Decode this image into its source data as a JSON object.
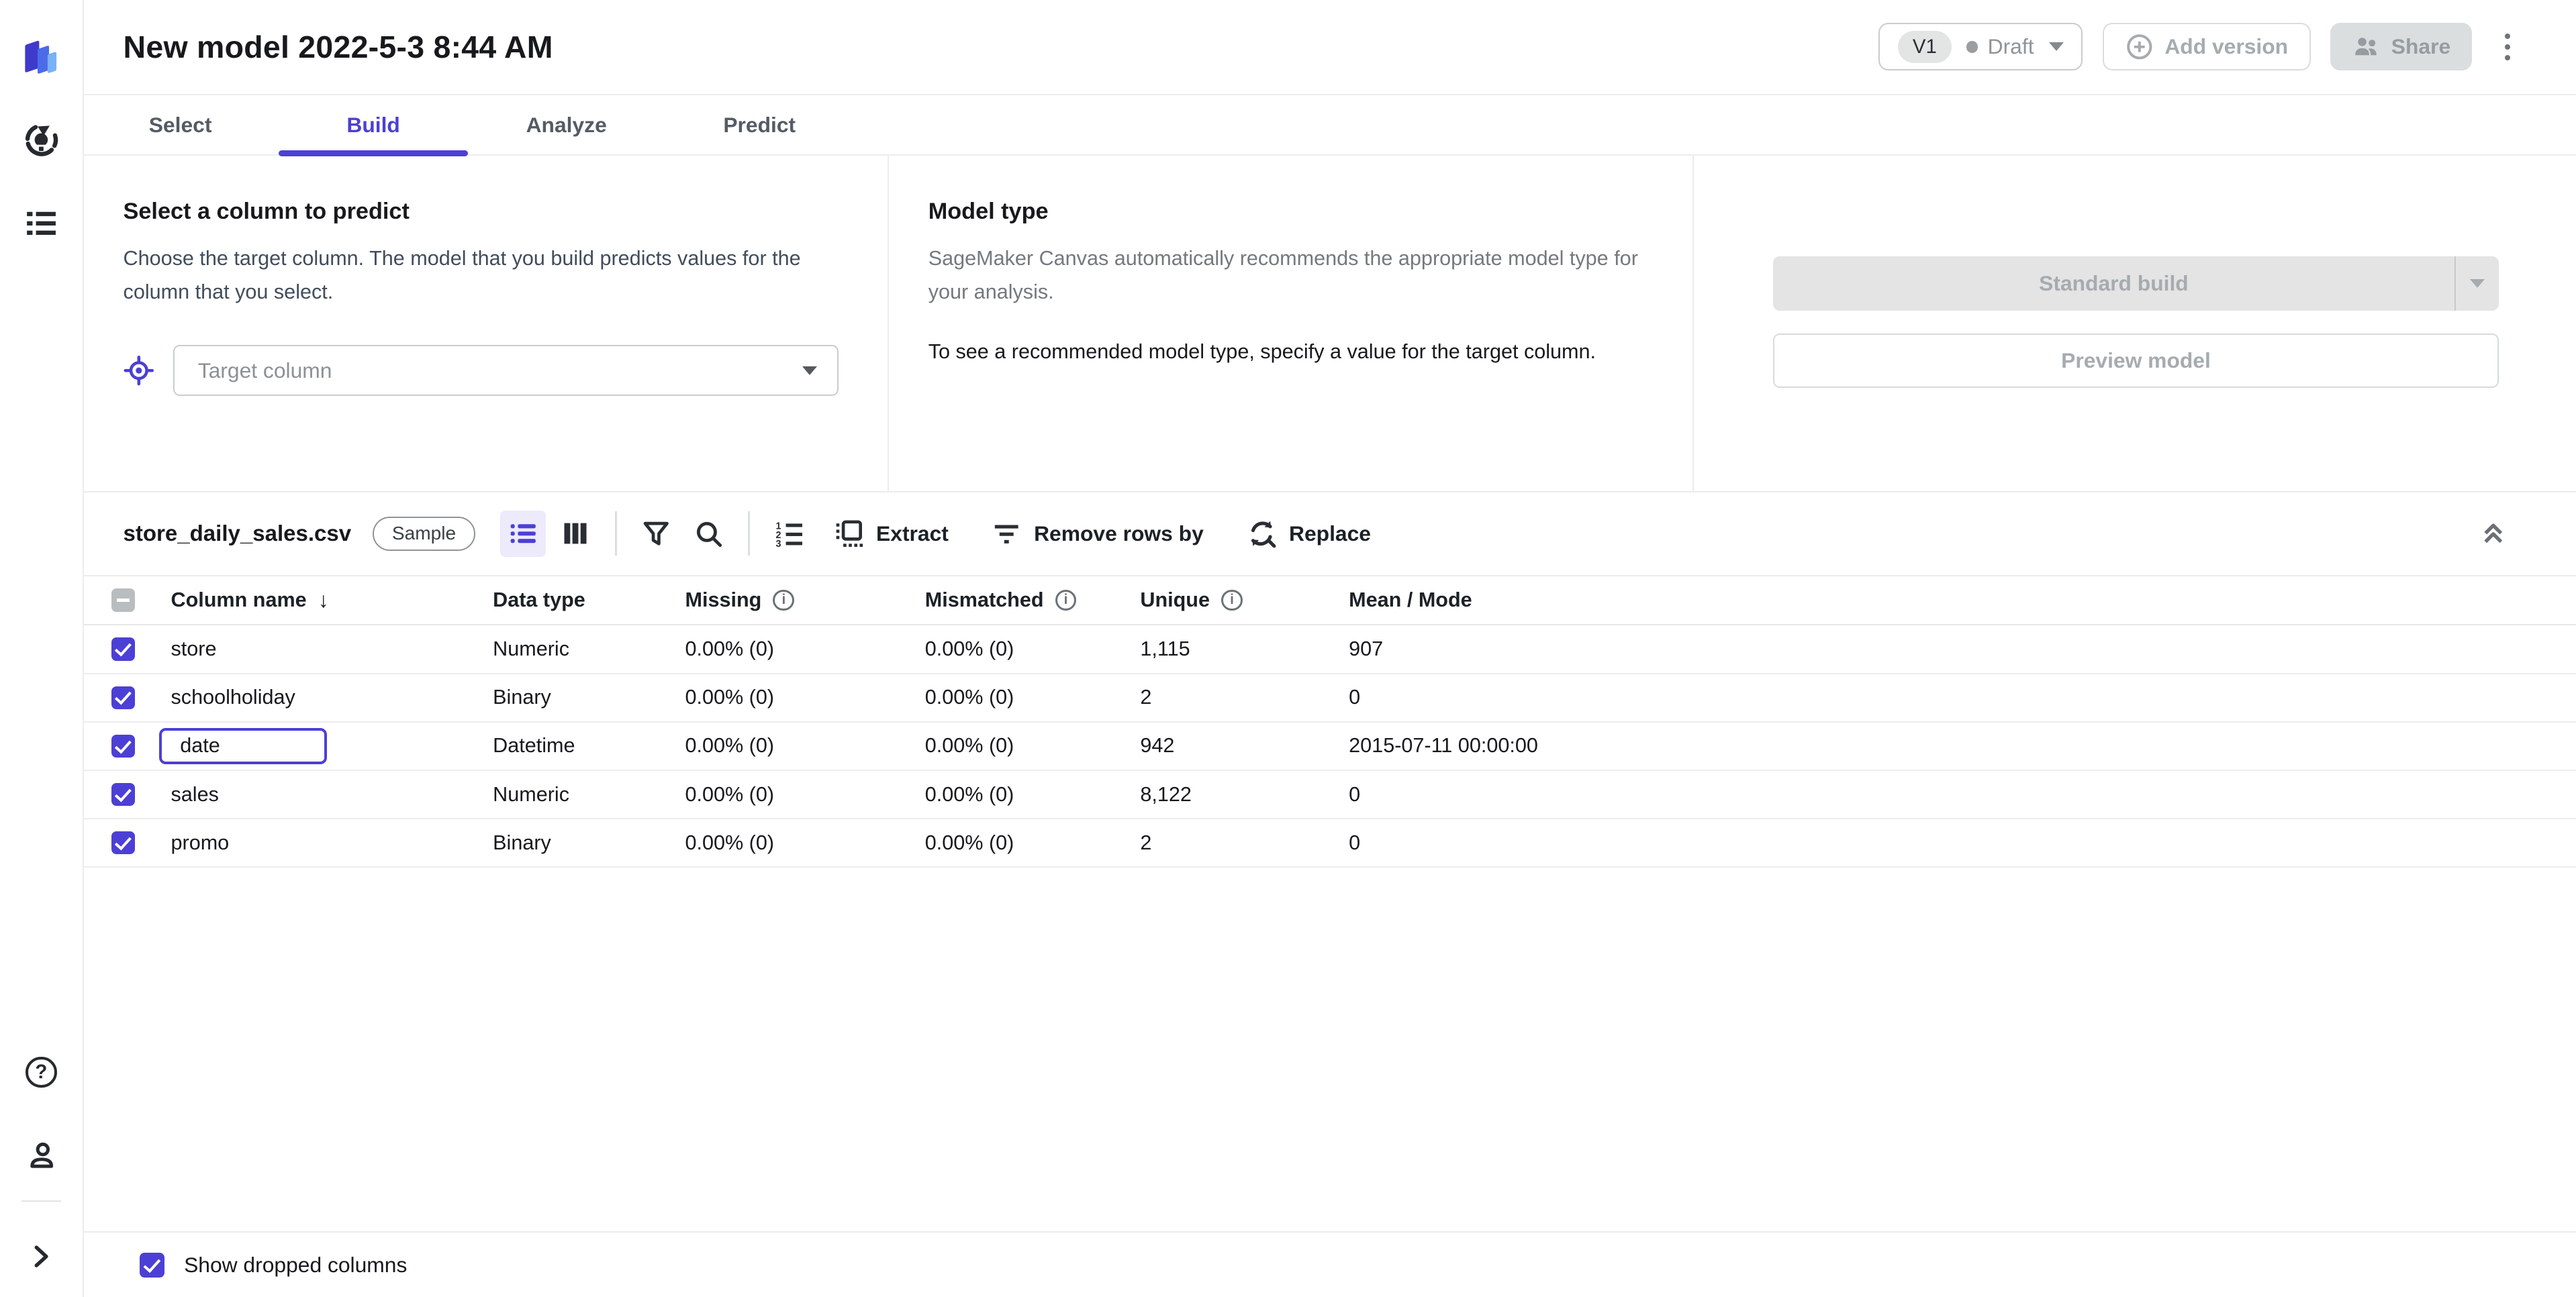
{
  "colors": {
    "accent": "#4C3FD6",
    "accent_light_bg": "#ECEAFB",
    "disabled_button_bg": "#E4E4E5",
    "disabled_text": "#A6ABAF",
    "logo_dark": "#3F3ACC",
    "logo_mid": "#4B6BE8",
    "logo_light": "#7AB1F7"
  },
  "sidebar": {
    "icons": [
      "canvas-logo",
      "models-icon",
      "datasets-icon",
      "help-icon",
      "account-icon",
      "expand-sidebar-icon"
    ]
  },
  "header": {
    "title": "New model 2022-5-3 8:44 AM",
    "version_badge": "V1",
    "status_label": "Draft",
    "add_version_label": "Add version",
    "share_label": "Share"
  },
  "tabs": {
    "select": "Select",
    "build": "Build",
    "analyze": "Analyze",
    "predict": "Predict"
  },
  "target_section": {
    "heading": "Select a column to predict",
    "description": "Choose the target column. The model that you build predicts values for the column that you select.",
    "dropdown_placeholder": "Target column"
  },
  "model_type_section": {
    "heading": "Model type",
    "description": "SageMaker Canvas automatically recommends the appropriate model type for your analysis.",
    "note": "To see a recommended model type, specify a value for the target column."
  },
  "actions": {
    "standard_build": "Standard build",
    "preview_model": "Preview model"
  },
  "glyphs": {
    "sort_desc": "↓",
    "info": "i",
    "help": "?"
  },
  "dataset": {
    "filename": "store_daily_sales.csv",
    "sample_label": "Sample",
    "toolbar": {
      "icons": [
        "list-view-icon",
        "column-view-icon",
        "filter-icon",
        "search-icon",
        "numbered-list-icon",
        "extract-icon",
        "remove-rows-icon",
        "replace-icon",
        "collapse-panel-icon"
      ],
      "extract_label": "Extract",
      "remove_rows_label": "Remove rows by",
      "replace_label": "Replace"
    },
    "table": {
      "headers": {
        "column_name": "Column name",
        "data_type": "Data type",
        "missing": "Missing",
        "mismatched": "Mismatched",
        "unique": "Unique",
        "mean_mode": "Mean / Mode"
      },
      "rows": [
        {
          "name": "store",
          "data_type": "Numeric",
          "missing": "0.00% (0)",
          "mismatched": "0.00% (0)",
          "unique": "1,115",
          "mean_mode": "907"
        },
        {
          "name": "schoolholiday",
          "data_type": "Binary",
          "missing": "0.00% (0)",
          "mismatched": "0.00% (0)",
          "unique": "2",
          "mean_mode": "0"
        },
        {
          "name": "date",
          "data_type": "Datetime",
          "missing": "0.00% (0)",
          "mismatched": "0.00% (0)",
          "unique": "942",
          "mean_mode": "2015-07-11 00:00:00"
        },
        {
          "name": "sales",
          "data_type": "Numeric",
          "missing": "0.00% (0)",
          "mismatched": "0.00% (0)",
          "unique": "8,122",
          "mean_mode": "0"
        },
        {
          "name": "promo",
          "data_type": "Binary",
          "missing": "0.00% (0)",
          "mismatched": "0.00% (0)",
          "unique": "2",
          "mean_mode": "0"
        }
      ]
    },
    "footer": {
      "show_dropped_label": "Show dropped columns"
    }
  }
}
